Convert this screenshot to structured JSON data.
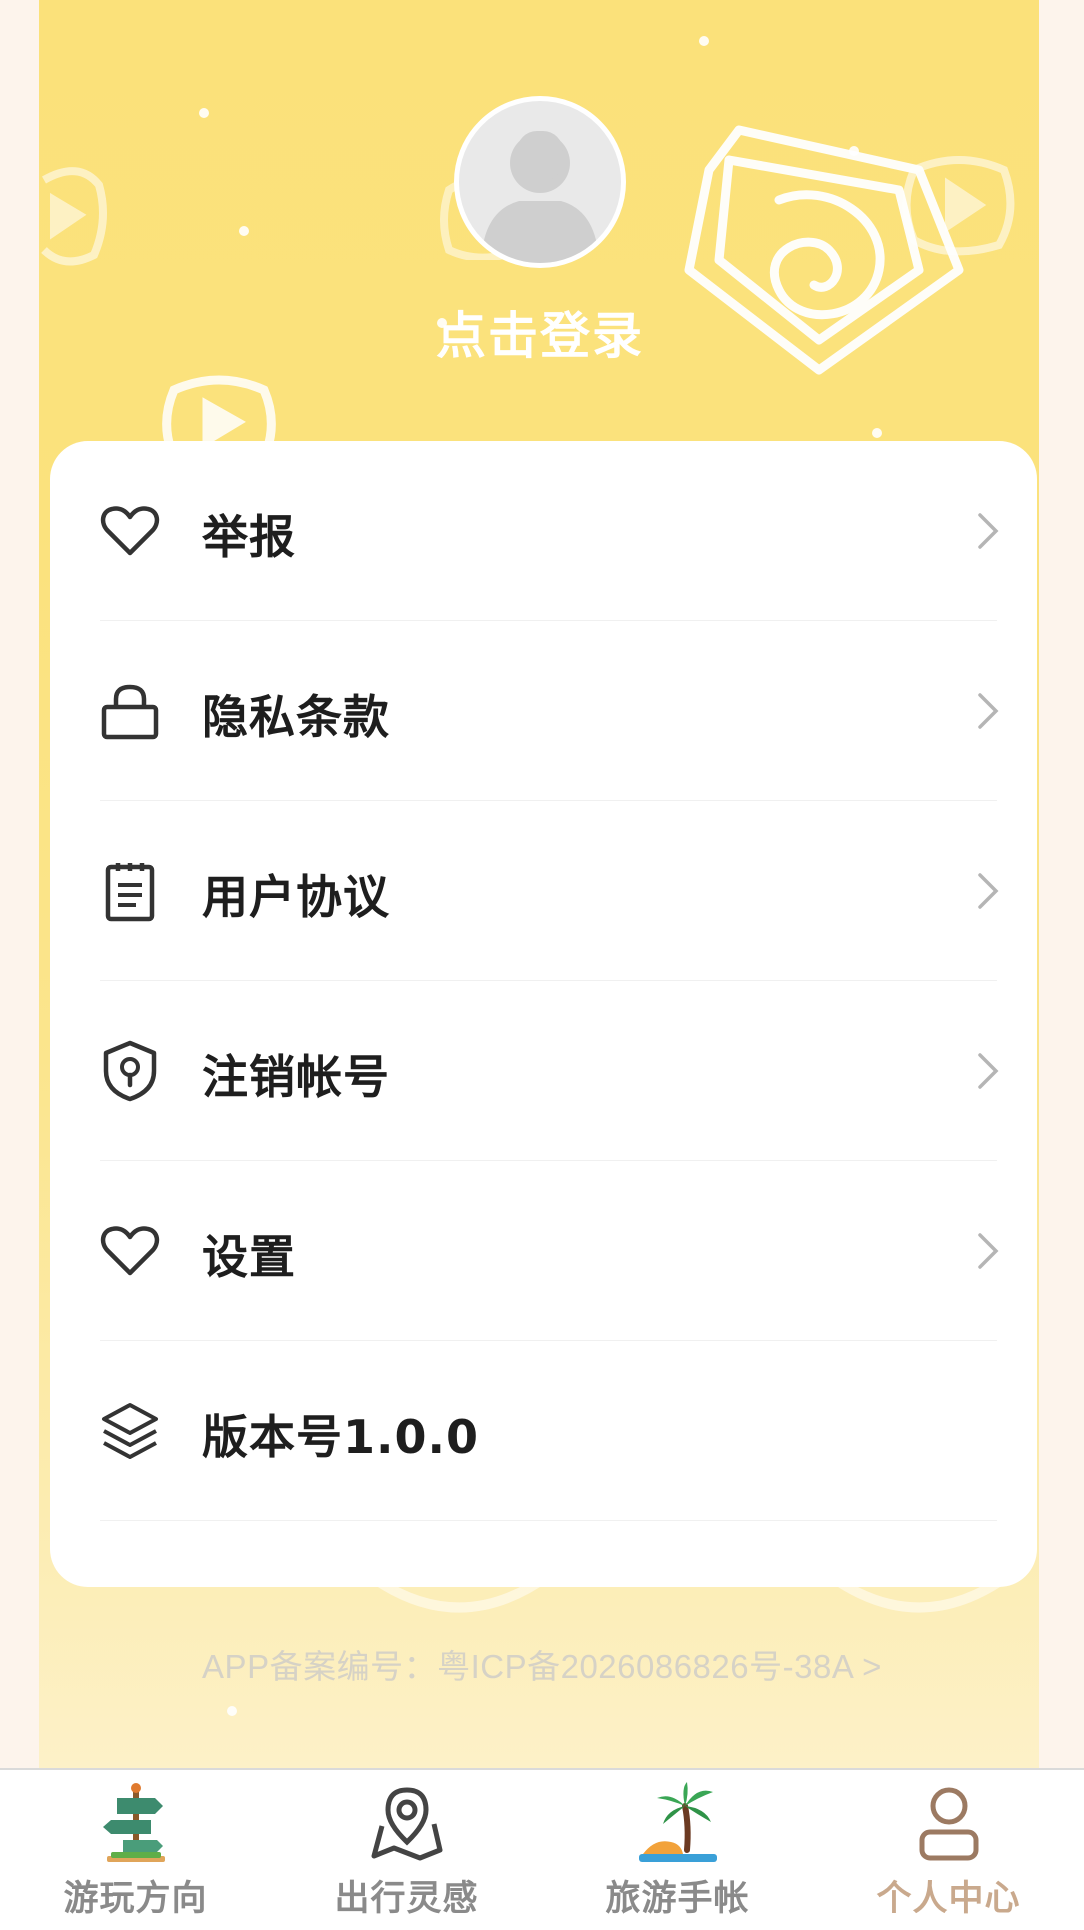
{
  "profile": {
    "login_text": "点击登录"
  },
  "menu": {
    "items": [
      {
        "label": "举报",
        "icon": "heart-icon",
        "has_arrow": true
      },
      {
        "label": "隐私条款",
        "icon": "lock-icon",
        "has_arrow": true
      },
      {
        "label": "用户协议",
        "icon": "document-icon",
        "has_arrow": true
      },
      {
        "label": "注销帐号",
        "icon": "shield-icon",
        "has_arrow": true
      },
      {
        "label": "设置",
        "icon": "heart-icon",
        "has_arrow": true
      },
      {
        "label": "版本号1.0.0",
        "icon": "layers-icon",
        "has_arrow": false
      }
    ]
  },
  "footer": {
    "icp_text": "APP备案编号：粤ICP备2026086826号-38A >"
  },
  "tabbar": {
    "tabs": [
      {
        "label": "游玩方向",
        "icon": "signpost-icon",
        "active": false
      },
      {
        "label": "出行灵感",
        "icon": "map-pin-icon",
        "active": false
      },
      {
        "label": "旅游手帐",
        "icon": "palm-tree-icon",
        "active": false
      },
      {
        "label": "个人中心",
        "icon": "person-icon",
        "active": true
      }
    ]
  },
  "colors": {
    "header_yellow": "#fbe17a",
    "active_tab": "#c9a98d",
    "inactive_tab": "#8a8a8a"
  }
}
